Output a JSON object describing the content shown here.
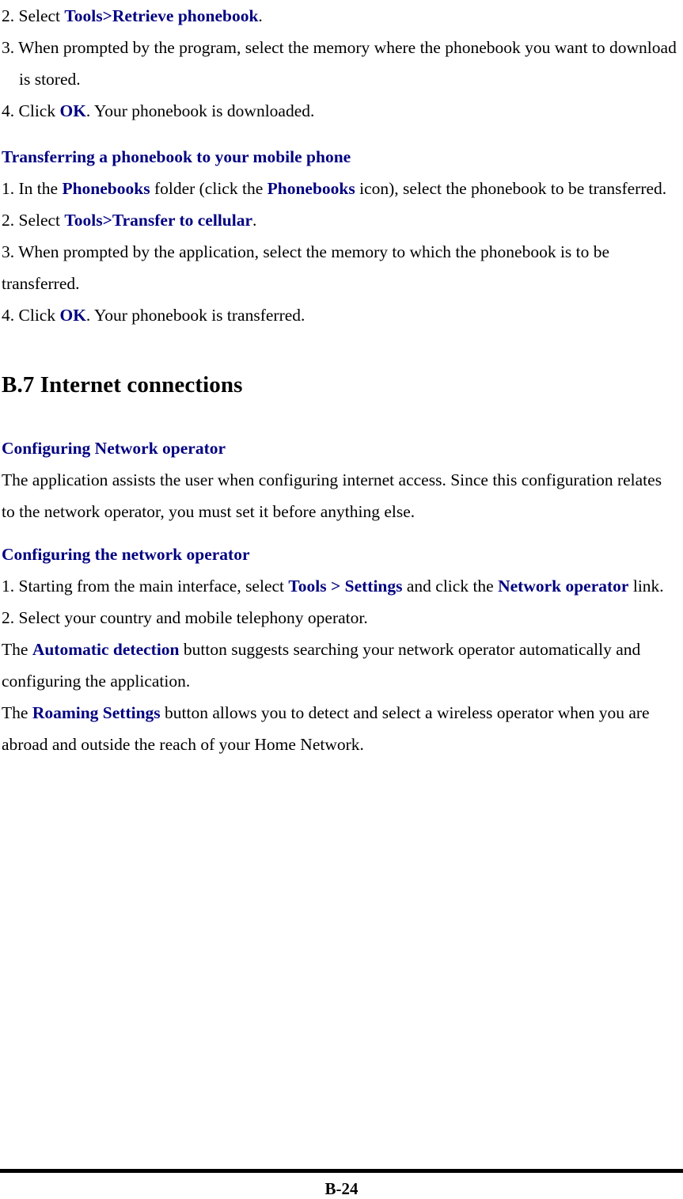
{
  "document": {
    "page_number_label": "B-24"
  },
  "blocks": {
    "step_download_2": {
      "prefix": "2. Select ",
      "emphasis": "Tools>Retrieve phonebook",
      "suffix": "."
    },
    "step_download_3": "3. When prompted by the program, select the memory where the phonebook you want to download is stored.",
    "step_download_4": {
      "prefix": "4. Click ",
      "emphasis": "OK",
      "suffix": ". Your phonebook is downloaded."
    },
    "heading_transferring": "Transferring a phonebook to your mobile phone",
    "step_transfer_1": {
      "prefix": "1. In the ",
      "emphasis1": "Phonebooks",
      "middle": " folder (click the ",
      "emphasis2": "Phonebooks",
      "suffix": " icon), select the phonebook to be transferred."
    },
    "step_transfer_2": {
      "prefix": "2. Select ",
      "emphasis": "Tools>Transfer to cellular",
      "suffix": "."
    },
    "step_transfer_3": "3. When prompted by the application, select the memory to which the phonebook is to be transferred.",
    "step_transfer_4": {
      "prefix": "4. Click ",
      "emphasis": "OK",
      "suffix": ". Your phonebook is transferred."
    },
    "section_b7": "B.7 Internet connections",
    "heading_configuring_network_operator": "Configuring Network operator",
    "para_application_assists": "The application assists the user when configuring internet access. Since this configuration relates to the network operator, you must set it before anything else.",
    "heading_configuring_the_network_operator": "Configuring the network operator",
    "step_config_1": {
      "prefix": "1. Starting from the main interface, select ",
      "emphasis1": "Tools",
      "sep": " > ",
      "emphasis2": "Settings",
      "middle": " and click the ",
      "emphasis3": "Network operator",
      "suffix": " link."
    },
    "step_config_2": "2. Select your country and mobile telephony operator.",
    "para_automatic_detection": {
      "prefix": "The ",
      "emphasis": "Automatic detection",
      "suffix": " button suggests searching your network operator automatically and configuring the application."
    },
    "para_roaming_settings": {
      "prefix": "The ",
      "emphasis": "Roaming Settings",
      "suffix": " button allows you to detect and select a wireless operator when you are abroad and outside the reach of your Home Network."
    }
  },
  "colors": {
    "emphasis_blue": "#000080",
    "body_black": "#000000",
    "page_background": "#ffffff"
  }
}
